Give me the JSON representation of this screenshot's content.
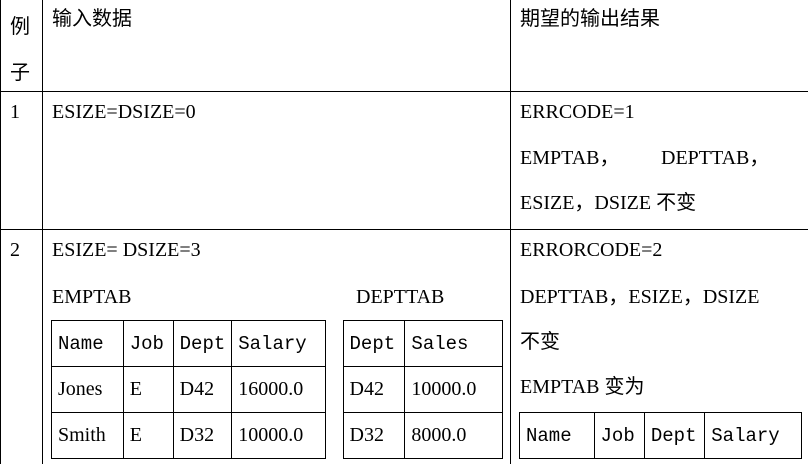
{
  "header": {
    "col1": "例子",
    "col2": "输入数据",
    "col3": "期望的输出结果"
  },
  "rows": [
    {
      "num": "1",
      "input_line1": "ESIZE=DSIZE=0",
      "output_line1": "ERRCODE=1",
      "output_line2": "EMPTAB，",
      "output_line2b": "DEPTTAB，",
      "output_line3": "ESIZE，DSIZE 不变"
    },
    {
      "num": "2",
      "input_line1": "ESIZE= DSIZE=3",
      "input_emptab_label": "EMPTAB",
      "input_depttab_label": "DEPTTAB",
      "emp_table": {
        "headers": [
          "Name",
          "Job",
          "Dept",
          "Salary"
        ],
        "rows": [
          [
            "Jones",
            "E",
            "D42",
            "16000.0"
          ],
          [
            "Smith",
            "E",
            "D32",
            "10000.0"
          ]
        ]
      },
      "dept_table": {
        "headers": [
          "Dept",
          "Sales"
        ],
        "rows": [
          [
            "D42",
            "10000.0"
          ],
          [
            "D32",
            "8000.0"
          ]
        ]
      },
      "output_line1": "ERRORCODE=2",
      "output_line2": "DEPTTAB，ESIZE，DSIZE",
      "output_line3": "不变",
      "output_line4": "EMPTAB 变为",
      "output_table_headers": [
        "Name",
        "Job",
        "Dept",
        "Salary"
      ]
    }
  ]
}
